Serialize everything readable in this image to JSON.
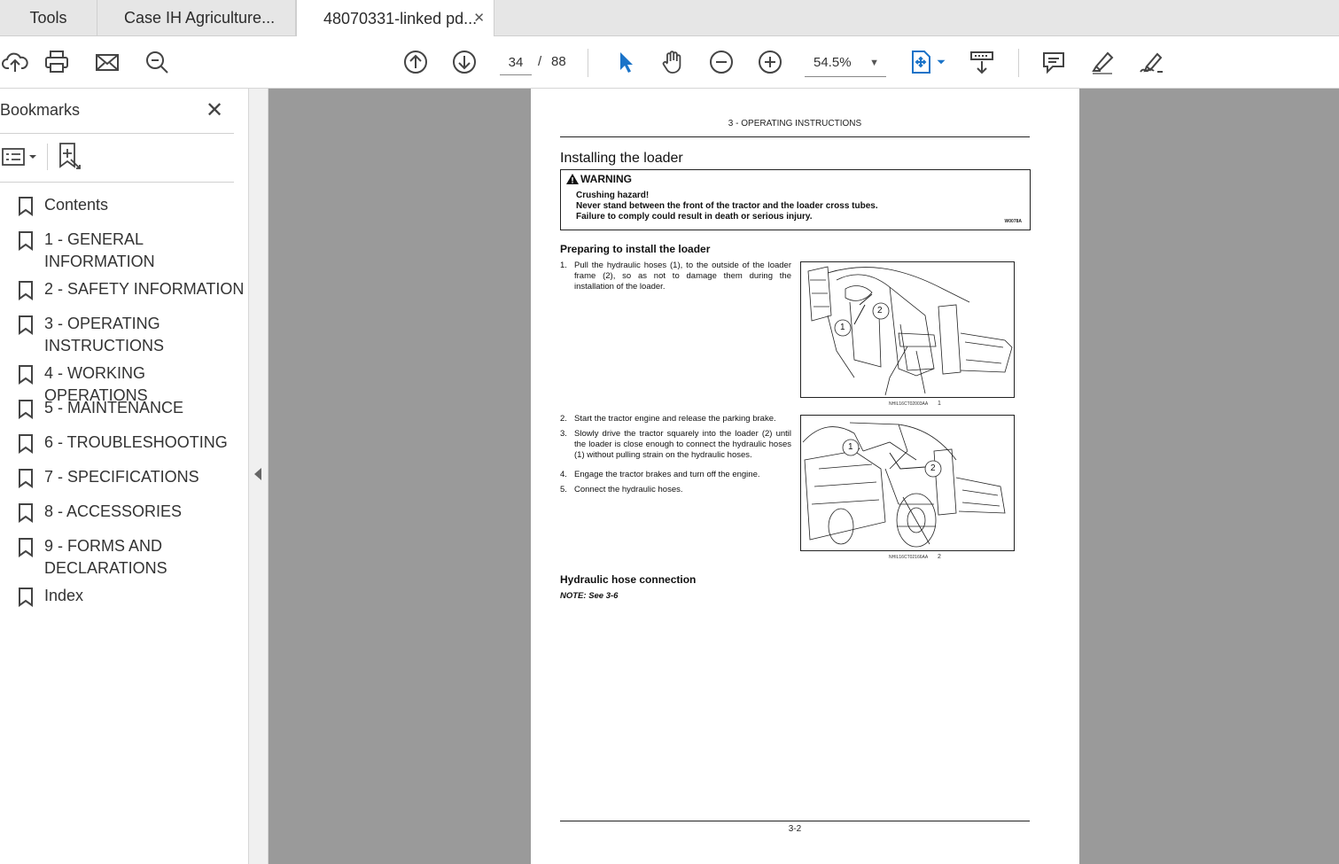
{
  "tabs": [
    {
      "label": "Tools"
    },
    {
      "label": "Case IH Agriculture..."
    },
    {
      "label": "48070331-linked pd...",
      "close": "✕"
    }
  ],
  "toolbar": {
    "current_page": "34",
    "page_separator": "/",
    "total_pages": "88",
    "zoom": "54.5%",
    "icons": [
      "upload-cloud-icon",
      "print-icon",
      "mail-icon",
      "search-zoom-icon",
      "page-up-icon",
      "page-down-icon",
      "select-cursor-icon",
      "hand-pan-icon",
      "zoom-out-icon",
      "zoom-in-icon",
      "fit-page-icon",
      "scroll-mode-icon",
      "comment-icon",
      "highlight-pen-icon",
      "sign-icon"
    ],
    "accent_color": "#1a73c8"
  },
  "sidebar": {
    "title": "Bookmarks",
    "close": "✕",
    "bookmarks": [
      {
        "label": "Contents"
      },
      {
        "label": "1 - GENERAL INFORMATION"
      },
      {
        "label": "2 - SAFETY INFORMATION"
      },
      {
        "label": "3 - OPERATING INSTRUCTIONS"
      },
      {
        "label": "4 - WORKING OPERATIONS"
      },
      {
        "label": "5 - MAINTENANCE"
      },
      {
        "label": "6 - TROUBLESHOOTING"
      },
      {
        "label": "7 - SPECIFICATIONS"
      },
      {
        "label": "8 - ACCESSORIES"
      },
      {
        "label": "9 - FORMS AND DECLARATIONS"
      },
      {
        "label": "Index"
      }
    ]
  },
  "document": {
    "header": "3 - OPERATING INSTRUCTIONS",
    "section_title": "Installing the loader",
    "warning": {
      "heading": "WARNING",
      "lines": [
        "Crushing hazard!",
        "Never stand between the front of the tractor and the loader cross tubes.",
        "Failure to comply could result in death or serious injury."
      ],
      "code": "W0078A"
    },
    "subheading1": "Preparing to install the loader",
    "steps": [
      {
        "n": "1.",
        "text": "Pull the hydraulic hoses (1), to the outside of the loader frame (2), so as not to damage them during the installation of the loader."
      },
      {
        "n": "2.",
        "text": "Start the tractor engine and release the parking brake."
      },
      {
        "n": "3.",
        "text": "Slowly drive the tractor squarely into the loader (2) until the loader is close enough to connect the hydraulic hoses (1) without pulling strain on the hydraulic hoses."
      },
      {
        "n": "4.",
        "text": "Engage the tractor brakes and turn off the engine."
      },
      {
        "n": "5.",
        "text": "Connect the hydraulic hoses."
      }
    ],
    "figures": [
      {
        "caption": "NHIL16CT02003AA",
        "number": "1",
        "callouts": [
          "1",
          "2"
        ]
      },
      {
        "caption": "NHIL16CT02166AA",
        "number": "2",
        "callouts": [
          "1",
          "2"
        ]
      }
    ],
    "subheading2": "Hydraulic hose connection",
    "note": "NOTE: See 3-6",
    "footer": "3-2"
  }
}
